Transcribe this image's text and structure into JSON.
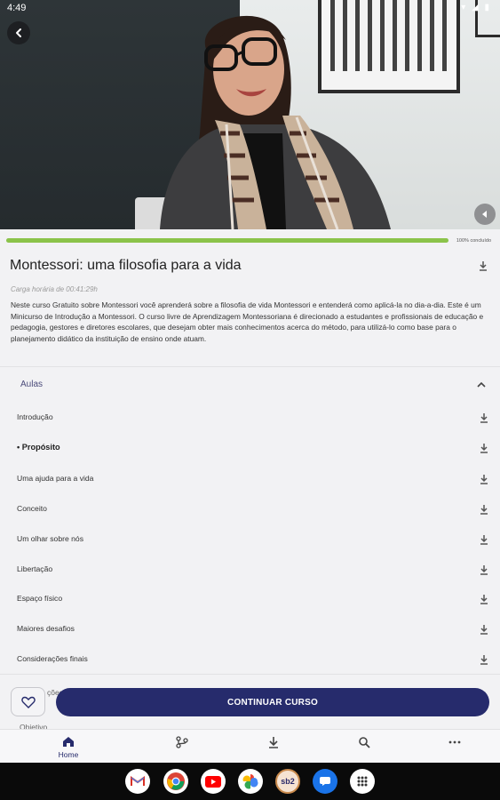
{
  "status_bar": {
    "time": "4:49"
  },
  "course": {
    "title": "Montessori: uma filosofia para a vida",
    "duration": "Carga horária de 00:41:29h",
    "description": "Neste curso Gratuito sobre Montessori você aprenderá sobre a filosofia de vida Montessori e entenderá como aplicá-la no dia-a-dia. Este é um Minicurso de Introdução a Montessori.  O curso livre de Aprendizagem Montessoriana é direcionado a estudantes e profissionais de educação e pedagogia, gestores e diretores escolares, que desejam obter mais conhecimentos acerca do método, para utilizá-lo como base para o planejamento didático da instituição de ensino onde atuam.",
    "progress_fraction": 1.0,
    "progress_label": "100% concluído"
  },
  "lessons": {
    "header": "Aulas",
    "items": [
      {
        "label": "Introdução",
        "active": false
      },
      {
        "label": "• Propósito",
        "active": true
      },
      {
        "label": "Uma ajuda para a vida",
        "active": false
      },
      {
        "label": "Conceito",
        "active": false
      },
      {
        "label": "Um olhar sobre nós",
        "active": false
      },
      {
        "label": "Libertação",
        "active": false
      },
      {
        "label": "Espaço físico",
        "active": false
      },
      {
        "label": "Maiores desafios",
        "active": false
      },
      {
        "label": "Considerações finais",
        "active": false
      }
    ]
  },
  "partial_sections": {
    "a": "ções",
    "b": "Objetivo"
  },
  "actions": {
    "continue_label": "CONTINUAR CURSO"
  },
  "tabbar": {
    "tabs": [
      {
        "icon": "home-icon",
        "label": "Home"
      },
      {
        "icon": "learning-path-icon",
        "label": ""
      },
      {
        "icon": "download-icon",
        "label": ""
      },
      {
        "icon": "search-icon",
        "label": ""
      },
      {
        "icon": "more-icon",
        "label": ""
      }
    ]
  },
  "taskbar": {
    "apps": [
      "gmail-icon",
      "chrome-icon",
      "youtube-icon",
      "photos-icon",
      "sebrae-app-icon",
      "messages-icon",
      "app-drawer-icon"
    ],
    "sebrae_label": "sb2"
  },
  "colors": {
    "accent": "#262b6c",
    "progress": "#8bc34a"
  }
}
